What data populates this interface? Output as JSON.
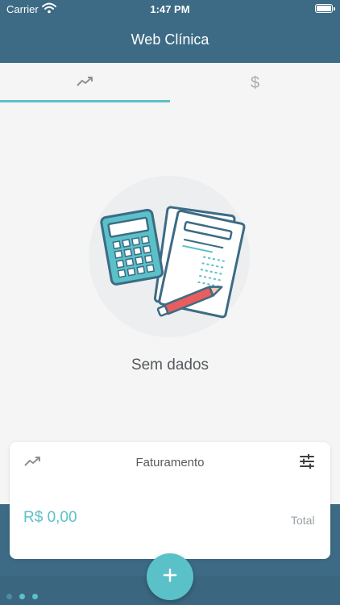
{
  "status_bar": {
    "carrier": "Carrier",
    "time": "1:47 PM",
    "wifi_icon": "wifi-icon",
    "battery_icon": "battery-icon"
  },
  "nav": {
    "title": "Web Clínica"
  },
  "tabs": [
    {
      "icon": "trending-up-icon",
      "active": true
    },
    {
      "icon": "dollar-icon",
      "label": "$",
      "active": false
    }
  ],
  "empty_state": {
    "illustration": "calculator-documents-pen-illustration",
    "message": "Sem dados"
  },
  "card": {
    "icon": "trending-up-icon",
    "title": "Faturamento",
    "filter_icon": "filter-sliders-icon",
    "amount": "R$ 0,00",
    "total_label": "Total"
  },
  "fab": {
    "icon": "plus-icon"
  },
  "page_dots": 3,
  "colors": {
    "primary": "#3d6b85",
    "accent": "#5bc1c8",
    "background": "#f5f5f5",
    "text": "#555a5e"
  }
}
